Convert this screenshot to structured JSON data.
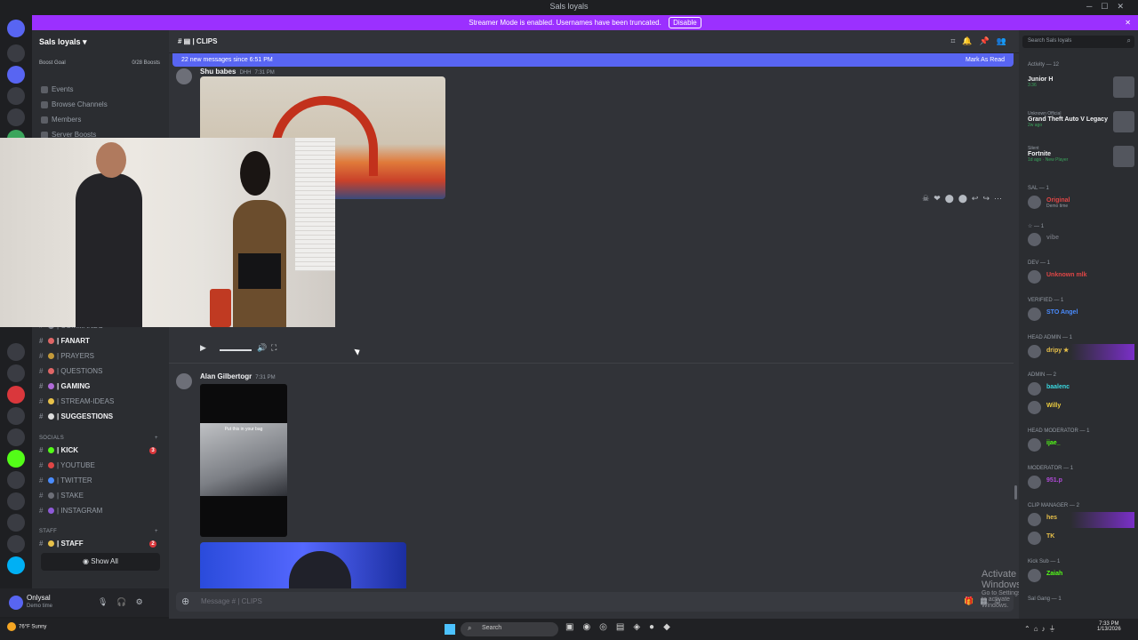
{
  "window": {
    "title": "Sals loyals"
  },
  "banner": {
    "text": "Streamer Mode is enabled. Usernames have been truncated.",
    "disable_label": "Disable"
  },
  "sidebar": {
    "server_name": "Sals loyals",
    "boost_goal": "Boost Goal",
    "boost_count": "0/28 Boosts",
    "nav": [
      "Events",
      "Browse Channels",
      "Members",
      "Server Boosts"
    ],
    "channels": [
      {
        "name": "| COMMANDS",
        "color": "#80848e"
      },
      {
        "name": "| FANART",
        "color": "#e06666",
        "bold": true
      },
      {
        "name": "| PRAYERS",
        "color": "#c49a3a"
      },
      {
        "name": "| QUESTIONS",
        "color": "#e06666"
      },
      {
        "name": "| GAMING",
        "color": "#b06ad8",
        "bold": true
      },
      {
        "name": "| STREAM-IDEAS",
        "color": "#e8c14a"
      },
      {
        "name": "| SUGGESTIONS",
        "color": "#dddddd",
        "bold": true
      }
    ],
    "socials_label": "SOCIALS",
    "socials": [
      {
        "name": "| KICK",
        "color": "#53fc18",
        "bold": true,
        "badge": "3"
      },
      {
        "name": "| YOUTUBE",
        "color": "#e04646"
      },
      {
        "name": "| TWITTER",
        "color": "#4a8cff"
      },
      {
        "name": "| STAKE",
        "color": "#6d6f78"
      },
      {
        "name": "| INSTAGRAM",
        "color": "#8e5ad8"
      }
    ],
    "staff_label": "STAFF",
    "staff": [
      {
        "name": "| STAFF",
        "color": "#e8c14a",
        "bold": true,
        "badge": "2"
      }
    ],
    "show_all": "Show All"
  },
  "user": {
    "name": "Onlysal",
    "status": "Demo time"
  },
  "channel": {
    "name": "| CLIPS",
    "new_messages": "22 new messages since 6:51 PM",
    "mark_as_read": "Mark As Read"
  },
  "messages": [
    {
      "author": "Shu babes",
      "tag": "DHH",
      "time": "7:31 PM"
    },
    {
      "author": "Alan Gilbertogr",
      "time": "7:31 PM",
      "video_caption": "Put this in your bag"
    }
  ],
  "composer": {
    "placeholder": "Message # | CLIPS"
  },
  "overlay": {
    "activate_title": "Activate Windows",
    "activate_sub": "Go to Settings to activate Windows."
  },
  "rightbar": {
    "search_placeholder": "Search Sals loyals",
    "activity_label": "Activity — 12",
    "activities": [
      {
        "top": "",
        "name": "Junior H",
        "sub": "3:36"
      },
      {
        "top": "Unknown Official",
        "name": "Grand Theft Auto V Legacy",
        "sub": "2w ago"
      },
      {
        "top": "Silent",
        "name": "Fortnite",
        "sub": "1d ago · New Player"
      }
    ],
    "roles": [
      {
        "label": "SAL — 1",
        "members": [
          {
            "name": "Original",
            "status": "Demo time",
            "color": "#e04646"
          }
        ]
      },
      {
        "label": "☆ — 1",
        "members": [
          {
            "name": "vibe",
            "status": "",
            "color": "#6d6f78"
          }
        ]
      },
      {
        "label": "DEV — 1",
        "members": [
          {
            "name": "Unknown mlk",
            "status": "",
            "color": "#e04646"
          }
        ]
      },
      {
        "label": "VERIFIED — 1",
        "members": [
          {
            "name": "STO Angel",
            "status": "",
            "color": "#4a8cff"
          }
        ]
      },
      {
        "label": "HEAD ADMIN — 1",
        "members": [
          {
            "name": "dripy ★",
            "status": "",
            "color": "#e8c14a",
            "hl": true
          }
        ]
      },
      {
        "label": "ADMIN — 2",
        "members": [
          {
            "name": "baalenc",
            "status": "",
            "color": "#3ad8e0"
          },
          {
            "name": "Willy",
            "status": "",
            "color": "#f0d040"
          }
        ]
      },
      {
        "label": "HEAD MODERATOR — 1",
        "members": [
          {
            "name": "ijae_",
            "status": "",
            "color": "#53fc18"
          }
        ]
      },
      {
        "label": "MODERATOR — 1",
        "members": [
          {
            "name": "951.p",
            "status": "",
            "color": "#b04ad8"
          }
        ]
      },
      {
        "label": "CLIP MANAGER — 2",
        "members": [
          {
            "name": "hes",
            "status": "",
            "color": "#e8c14a",
            "hl": true
          },
          {
            "name": "TK",
            "status": "",
            "color": "#e8c14a"
          }
        ]
      },
      {
        "label": "Kick Sub — 1",
        "members": [
          {
            "name": "Zaiah",
            "status": "",
            "color": "#53fc18"
          }
        ]
      },
      {
        "label": "Sal Gang — 1",
        "members": []
      }
    ]
  },
  "taskbar": {
    "temp": "76°F",
    "weather": "Sunny",
    "search": "Search",
    "time": "7:33 PM",
    "date": "1/13/2026"
  }
}
